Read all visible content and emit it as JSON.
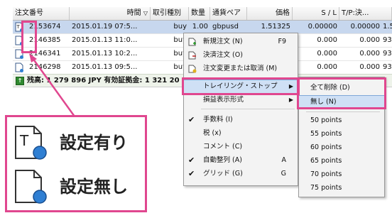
{
  "table": {
    "columns": [
      "注文番号",
      "時間",
      "取引種別",
      "数量",
      "通貨ペア",
      "価格",
      "S / L",
      "T/P:決..."
    ],
    "rows": [
      {
        "order": "2153674",
        "time": "2015.01.19 07:5...",
        "type": "buy",
        "qty": "1.00",
        "pair": "gbpusd",
        "price": "1.51325",
        "sl": "0.00000",
        "tp": "0.00000",
        "extra": "1.5"
      },
      {
        "order": "2146385",
        "time": "2015.01.13 11:0...",
        "type": "buy",
        "qty": "",
        "pair": "",
        "price": "",
        "sl": "0.000",
        "tp": "0.000",
        "extra": "93"
      },
      {
        "order": "2146341",
        "time": "2015.01.13 10:2...",
        "type": "buy",
        "qty": "",
        "pair": "",
        "price": "",
        "sl": "0.000",
        "tp": "0.000",
        "extra": "93"
      },
      {
        "order": "2146298",
        "time": "2015.01.13 09:5...",
        "type": "buy",
        "qty": "",
        "pair": "",
        "price": "",
        "sl": "0.000",
        "tp": "0.000",
        "extra": "93"
      }
    ],
    "balance": "残高: 1 279 896 JPY  有効証拠金: 1 321 20"
  },
  "context_menu": {
    "items": [
      {
        "label": "新規注文 (N)",
        "shortcut": "F9",
        "icon": "new-order-icon"
      },
      {
        "label": "決済注文 (O)",
        "shortcut": "",
        "icon": "close-order-icon"
      },
      {
        "label": "注文変更または取消 (M)",
        "shortcut": "",
        "icon": "modify-order-icon"
      },
      {
        "label": "トレイリング・ストップ",
        "shortcut": "",
        "arrow": "▶"
      },
      {
        "label": "損益表示形式",
        "shortcut": "",
        "arrow": "▶"
      },
      {
        "label": "手数料 (I)",
        "shortcut": "",
        "checked": true
      },
      {
        "label": "税 (x)",
        "shortcut": "",
        "checked": false
      },
      {
        "label": "コメント (C)",
        "shortcut": "",
        "checked": false
      },
      {
        "label": "自動整列 (A)",
        "shortcut": "A",
        "checked": true
      },
      {
        "label": "グリッド (G)",
        "shortcut": "G",
        "checked": true
      }
    ]
  },
  "submenu": {
    "items": [
      "全て削除 (D)",
      "無し (N)",
      "50 points",
      "55 points",
      "60 points",
      "65 points",
      "70 points",
      "75 points"
    ]
  },
  "legend": {
    "with_setting": "設定有り",
    "without_setting": "設定無し"
  },
  "colors": {
    "highlight": "#e0478f",
    "selected_row": "#c7d7ee",
    "menu_hover": "#cfe0f5"
  }
}
